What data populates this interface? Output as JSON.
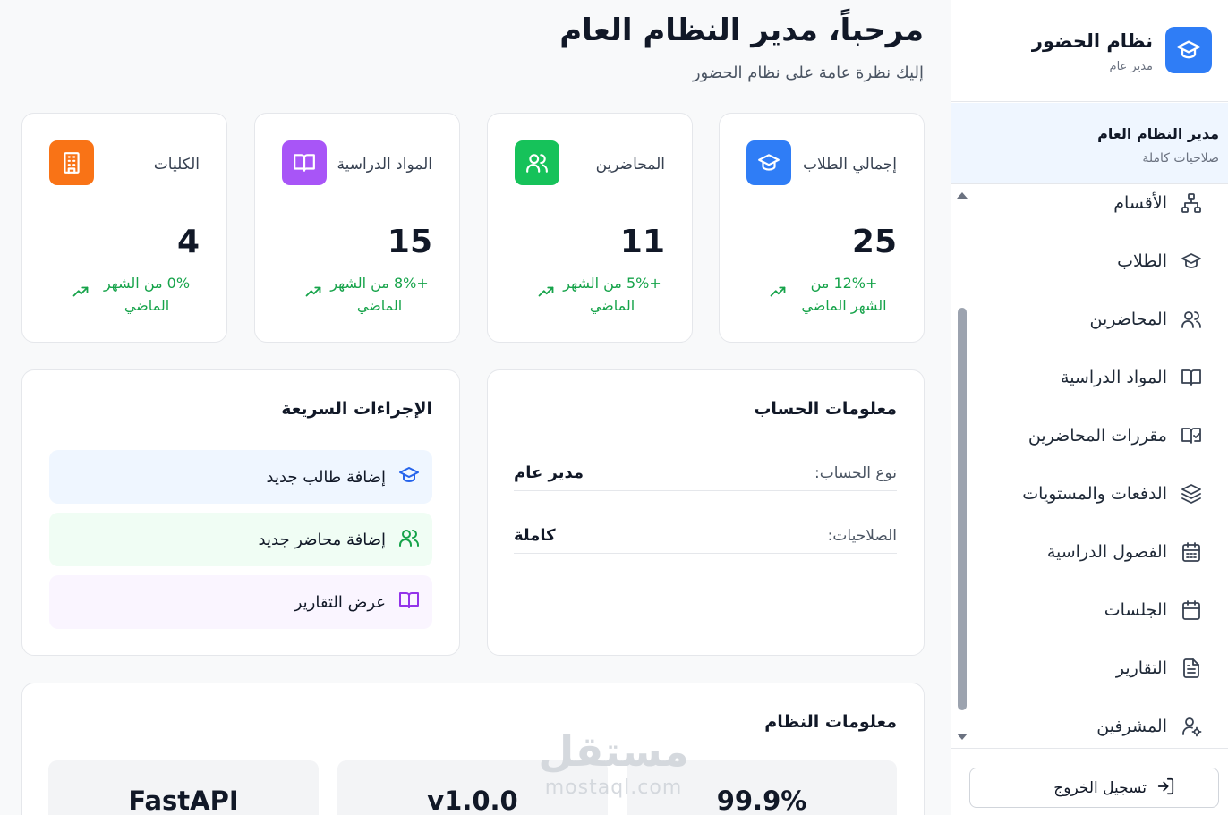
{
  "sidebar": {
    "brand_title": "نظام الحضور",
    "brand_subtitle": "مدير عام",
    "user_name": "مدير النظام العام",
    "user_permissions": "صلاحيات كاملة",
    "items": [
      {
        "label": "الأقسام",
        "icon": "hierarchy-icon"
      },
      {
        "label": "الطلاب",
        "icon": "graduation-cap-icon"
      },
      {
        "label": "المحاضرين",
        "icon": "users-icon"
      },
      {
        "label": "المواد الدراسية",
        "icon": "book-open-icon"
      },
      {
        "label": "مقررات المحاضرين",
        "icon": "book-check-icon"
      },
      {
        "label": "الدفعات والمستويات",
        "icon": "layers-icon"
      },
      {
        "label": "الفصول الدراسية",
        "icon": "calendar-grid-icon"
      },
      {
        "label": "الجلسات",
        "icon": "calendar-icon"
      },
      {
        "label": "التقارير",
        "icon": "document-icon"
      },
      {
        "label": "المشرفين",
        "icon": "user-gear-icon"
      }
    ],
    "logout_label": "تسجيل الخروج"
  },
  "header": {
    "title": "مرحباً، مدير النظام العام",
    "subtitle": "إليك نظرة عامة على نظام الحضور"
  },
  "stats": [
    {
      "label": "إجمالي الطلاب",
      "value": "25",
      "trend": "+12% من الشهر الماضي",
      "color": "#2f7df6",
      "icon": "graduation-cap-icon"
    },
    {
      "label": "المحاضرين",
      "value": "11",
      "trend": "+5% من الشهر الماضي",
      "color": "#16c25a",
      "icon": "users-icon"
    },
    {
      "label": "المواد الدراسية",
      "value": "15",
      "trend": "+8% من الشهر الماضي",
      "color": "#a855f7",
      "icon": "book-open-icon"
    },
    {
      "label": "الكليات",
      "value": "4",
      "trend": "0% من الشهر الماضي",
      "color": "#f97316",
      "icon": "building-icon"
    }
  ],
  "account": {
    "title": "معلومات الحساب",
    "rows": [
      {
        "key": "نوع الحساب:",
        "value": "مدير عام"
      },
      {
        "key": "الصلاحيات:",
        "value": "كاملة"
      }
    ]
  },
  "quick_actions": {
    "title": "الإجراءات السريعة",
    "items": [
      {
        "label": "إضافة طالب جديد",
        "icon": "graduation-cap-icon",
        "bg": "#eff6ff",
        "color": "#2563eb"
      },
      {
        "label": "إضافة محاضر جديد",
        "icon": "users-icon",
        "bg": "#f0fdf4",
        "color": "#16a34a"
      },
      {
        "label": "عرض التقارير",
        "icon": "book-open-icon",
        "bg": "#faf5ff",
        "color": "#9333ea"
      }
    ]
  },
  "system": {
    "title": "معلومات النظام",
    "tiles": [
      "99.9%",
      "v1.0.0",
      "FastAPI"
    ]
  },
  "watermark": {
    "arabic": "مستقل",
    "latin": "mostaql.com"
  }
}
